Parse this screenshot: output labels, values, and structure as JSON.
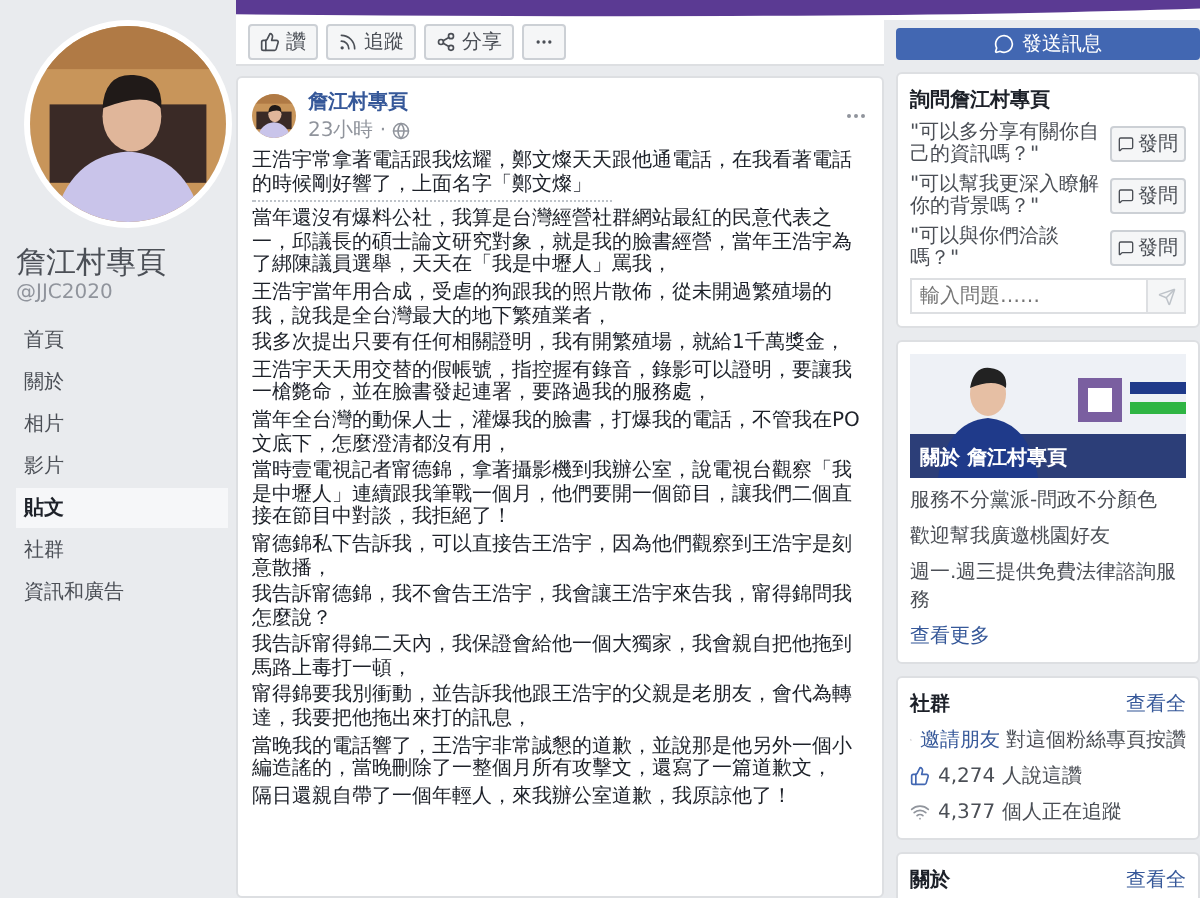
{
  "profile": {
    "name": "詹江村專頁",
    "handle": "@JJC2020"
  },
  "nav": [
    {
      "label": "首頁",
      "selected": false
    },
    {
      "label": "關於",
      "selected": false
    },
    {
      "label": "相片",
      "selected": false
    },
    {
      "label": "影片",
      "selected": false
    },
    {
      "label": "貼文",
      "selected": true
    },
    {
      "label": "社群",
      "selected": false
    },
    {
      "label": "資訊和廣告",
      "selected": false
    }
  ],
  "actions": [
    {
      "kind": "like",
      "label": "讚"
    },
    {
      "kind": "follow",
      "label": "追蹤"
    },
    {
      "kind": "share",
      "label": "分享"
    },
    {
      "kind": "more"
    }
  ],
  "post": {
    "author": "詹江村專頁",
    "time": "23小時 ·",
    "intro": "王浩宇常拿著電話跟我炫耀，鄭文燦天天跟他通電話，在我看著電話的時候剛好響了，上面名字「鄭文燦」",
    "paragraphs": [
      "當年還沒有爆料公社，我算是台灣經營社群網站最紅的民意代表之一，邱議長的碩士論文研究對象，就是我的臉書經營，當年王浩宇為了綁陳議員選舉，天天在「我是中壢人」罵我，",
      "王浩宇當年用合成，受虐的狗跟我的照片散佈，從未開過繁殖場的我，說我是全台灣最大的地下繁殖業者，",
      "我多次提出只要有任何相關證明，我有開繁殖場，就給1千萬獎金，",
      "王浩宇天天用交替的假帳號，指控握有錄音，錄影可以證明，要讓我一槍斃命，並在臉書發起連署，要路過我的服務處，",
      "當年全台灣的動保人士，灌爆我的臉書，打爆我的電話，不管我在PO文底下，怎麼澄清都沒有用，",
      "當時壹電視記者甯德錦，拿著攝影機到我辦公室，說電視台觀察「我是中壢人」連續跟我筆戰一個月，他們要開一個節目，讓我們二個直接在節目中對談，我拒絕了！",
      "甯德錦私下告訴我，可以直接告王浩宇，因為他們觀察到王浩宇是刻意散播，",
      "我告訴甯德錦，我不會告王浩宇，我會讓王浩宇來告我，甯得錦問我怎麼說？",
      "我告訴甯得錦二天內，我保證會給他一個大獨家，我會親自把他拖到馬路上毒打一頓，",
      "甯得錦要我別衝動，並告訴我他跟王浩宇的父親是老朋友，會代為轉達，我要把他拖出來打的訊息，",
      "當晚我的電話響了，王浩宇非常誠懇的道歉，並說那是他另外一個小編造謠的，當晚刪除了一整個月所有攻擊文，還寫了一篇道歉文，",
      "隔日還親自帶了一個年輕人，來我辦公室道歉，我原諒他了！"
    ]
  },
  "send_message": {
    "label": "發送訊息"
  },
  "ask": {
    "title": "詢問詹江村專頁",
    "questions": [
      {
        "text": "\"可以多分享有關你自己的資訊嗎？\"",
        "button": "發問"
      },
      {
        "text": "\"可以幫我更深入瞭解你的背景嗎？\"",
        "button": "發問"
      },
      {
        "text": "\"可以與你們洽談嗎？\"",
        "button": "發問"
      }
    ],
    "placeholder": "輸入問題……"
  },
  "banner": {
    "kind": "picture",
    "caption": "關於 詹江村專頁"
  },
  "intro_lines": [
    "服務不分黨派-問政不分顏色",
    "歡迎幫我廣邀桃園好友",
    "週一.週三提供免費法律諮詢服務"
  ],
  "see_more": "查看更多",
  "community": {
    "title": "社群",
    "see_all": "查看全",
    "items": [
      {
        "kind": "invite",
        "link": "邀請朋友",
        "text": "對這個粉絲專頁按讚"
      },
      {
        "kind": "likes",
        "text": "4,274 人說這讚"
      },
      {
        "kind": "follows",
        "text": "4,377 個人正在追蹤"
      }
    ]
  },
  "about": {
    "title": "關於",
    "see_all": "查看全"
  }
}
